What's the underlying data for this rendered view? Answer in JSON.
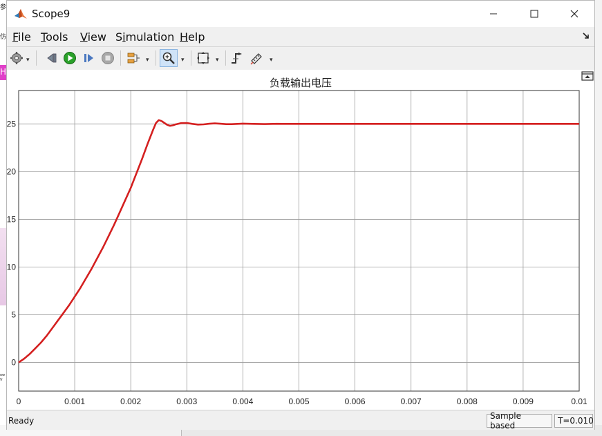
{
  "window": {
    "title": "Scope9"
  },
  "menu": {
    "file": {
      "key": "F",
      "rest": "ile"
    },
    "tools": {
      "key": "T",
      "rest": "ools"
    },
    "view": {
      "key": "V",
      "rest": "iew"
    },
    "simulation": {
      "pre": "S",
      "key": "i",
      "rest": "mulation"
    },
    "help": {
      "key": "H",
      "rest": "elp"
    }
  },
  "toolbar": {
    "items": [
      "gear-icon",
      "step-back-icon",
      "run-icon",
      "step-forward-icon",
      "stop-icon",
      "signal-selector-icon",
      "zoom-in-icon",
      "fit-to-view-icon",
      "triggers-icon",
      "measurements-icon"
    ],
    "active": "zoom-in-icon"
  },
  "status": {
    "text": "Ready",
    "mode": "Sample based",
    "time": "T=0.010"
  },
  "background": {
    "left_marks": [
      "参",
      "仿",
      "H",
      "ow",
      "V"
    ]
  },
  "colors": {
    "trace": "#d42020",
    "grid": "#9a9a9a",
    "accent": "#0a64c8"
  },
  "chart_data": {
    "type": "line",
    "title": "负载输出电压",
    "xlim": [
      0,
      0.01
    ],
    "ylim": [
      -3,
      28.5
    ],
    "x_ticks": [
      "0",
      "0.001",
      "0.002",
      "0.003",
      "0.004",
      "0.005",
      "0.006",
      "0.007",
      "0.008",
      "0.009",
      "0.01"
    ],
    "x_tick_values": [
      0,
      0.001,
      0.002,
      0.003,
      0.004,
      0.005,
      0.006,
      0.007,
      0.008,
      0.009,
      0.01
    ],
    "y_ticks": [
      "0",
      "5",
      "10",
      "15",
      "20",
      "25"
    ],
    "y_tick_values": [
      0,
      5,
      10,
      15,
      20,
      25
    ],
    "grid": true,
    "series": [
      {
        "values": [
          [
            0,
            0
          ],
          [
            0.0001,
            0.4
          ],
          [
            0.0002,
            0.9
          ],
          [
            0.0003,
            1.5
          ],
          [
            0.0004,
            2.1
          ],
          [
            0.0005,
            2.8
          ],
          [
            0.0006,
            3.6
          ],
          [
            0.0007,
            4.4
          ],
          [
            0.0008,
            5.2
          ],
          [
            0.0009,
            6.0
          ],
          [
            0.001,
            6.9
          ],
          [
            0.0011,
            7.8
          ],
          [
            0.0012,
            8.8
          ],
          [
            0.0013,
            9.8
          ],
          [
            0.0014,
            10.9
          ],
          [
            0.0015,
            12.0
          ],
          [
            0.0016,
            13.2
          ],
          [
            0.0017,
            14.4
          ],
          [
            0.0018,
            15.7
          ],
          [
            0.0019,
            17.0
          ],
          [
            0.002,
            18.3
          ],
          [
            0.0021,
            19.8
          ],
          [
            0.0022,
            21.3
          ],
          [
            0.0023,
            22.9
          ],
          [
            0.0024,
            24.4
          ],
          [
            0.00245,
            25.1
          ],
          [
            0.0025,
            25.4
          ],
          [
            0.00255,
            25.3
          ],
          [
            0.0026,
            25.1
          ],
          [
            0.00265,
            24.9
          ],
          [
            0.0027,
            24.8
          ],
          [
            0.00275,
            24.85
          ],
          [
            0.0028,
            24.95
          ],
          [
            0.0029,
            25.08
          ],
          [
            0.003,
            25.1
          ],
          [
            0.0031,
            25.0
          ],
          [
            0.0032,
            24.93
          ],
          [
            0.0033,
            24.95
          ],
          [
            0.0034,
            25.02
          ],
          [
            0.0035,
            25.05
          ],
          [
            0.0036,
            25.02
          ],
          [
            0.0037,
            24.97
          ],
          [
            0.0038,
            24.97
          ],
          [
            0.0039,
            25.0
          ],
          [
            0.004,
            25.03
          ],
          [
            0.0042,
            25.0
          ],
          [
            0.0044,
            24.98
          ],
          [
            0.0046,
            25.01
          ],
          [
            0.0048,
            25.0
          ],
          [
            0.005,
            25.0
          ],
          [
            0.006,
            25.0
          ],
          [
            0.007,
            25.0
          ],
          [
            0.008,
            25.0
          ],
          [
            0.009,
            25.0
          ],
          [
            0.01,
            25.0
          ]
        ]
      }
    ]
  }
}
